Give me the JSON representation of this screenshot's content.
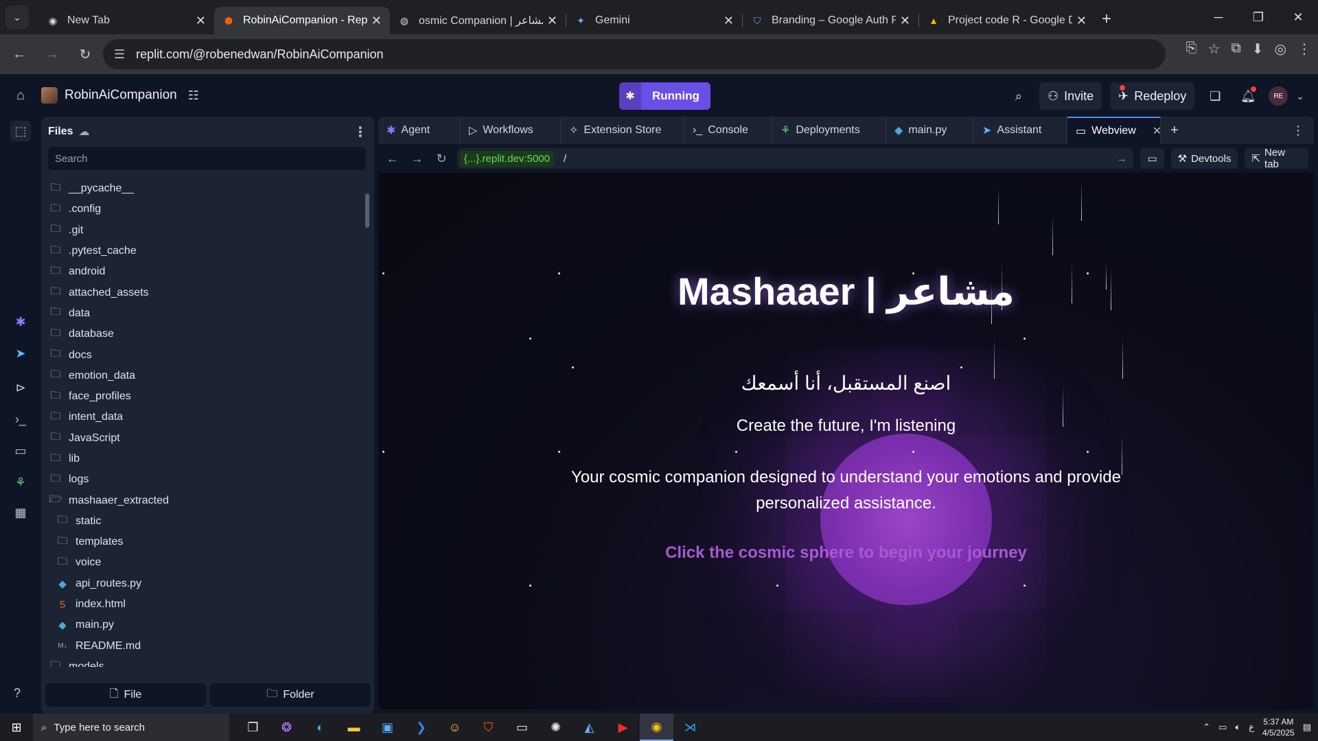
{
  "browser": {
    "tabs": [
      {
        "title": "New Tab",
        "icon": "chrome-icon"
      },
      {
        "title": "RobinAiCompanion - Repl",
        "icon": "replit-icon",
        "active": true
      },
      {
        "title": "osmic Companion | مشاعر",
        "icon": "globe-icon"
      },
      {
        "title": "Gemini",
        "icon": "gemini-icon"
      },
      {
        "title": "Branding – Google Auth P",
        "icon": "shield-icon"
      },
      {
        "title": "Project code R - Google D",
        "icon": "drive-icon"
      }
    ],
    "url": "replit.com/@robenedwan/RobinAiCompanion"
  },
  "replit": {
    "project_name": "RobinAiCompanion",
    "run_status": "Running",
    "invite_label": "Invite",
    "redeploy_label": "Redeploy",
    "user_initials": "RE"
  },
  "files": {
    "title": "Files",
    "search_placeholder": "Search",
    "items": [
      {
        "name": "__pycache__",
        "type": "folder",
        "depth": 0
      },
      {
        "name": ".config",
        "type": "folder",
        "depth": 0
      },
      {
        "name": ".git",
        "type": "folder",
        "depth": 0
      },
      {
        "name": ".pytest_cache",
        "type": "folder",
        "depth": 0
      },
      {
        "name": "android",
        "type": "folder",
        "depth": 0
      },
      {
        "name": "attached_assets",
        "type": "folder",
        "depth": 0
      },
      {
        "name": "data",
        "type": "folder",
        "depth": 0
      },
      {
        "name": "database",
        "type": "folder",
        "depth": 0
      },
      {
        "name": "docs",
        "type": "folder",
        "depth": 0
      },
      {
        "name": "emotion_data",
        "type": "folder",
        "depth": 0
      },
      {
        "name": "face_profiles",
        "type": "folder",
        "depth": 0
      },
      {
        "name": "intent_data",
        "type": "folder",
        "depth": 0
      },
      {
        "name": "JavaScript",
        "type": "folder",
        "depth": 0
      },
      {
        "name": "lib",
        "type": "folder",
        "depth": 0
      },
      {
        "name": "logs",
        "type": "folder",
        "depth": 0
      },
      {
        "name": "mashaaer_extracted",
        "type": "folder-open",
        "depth": 0
      },
      {
        "name": "static",
        "type": "folder",
        "depth": 1
      },
      {
        "name": "templates",
        "type": "folder",
        "depth": 1
      },
      {
        "name": "voice",
        "type": "folder",
        "depth": 1
      },
      {
        "name": "api_routes.py",
        "type": "python",
        "depth": 1
      },
      {
        "name": "index.html",
        "type": "html",
        "depth": 1
      },
      {
        "name": "main.py",
        "type": "python",
        "depth": 1
      },
      {
        "name": "README.md",
        "type": "markdown",
        "depth": 1
      },
      {
        "name": "models",
        "type": "folder",
        "depth": 0
      }
    ],
    "new_file_label": "File",
    "new_folder_label": "Folder"
  },
  "workspace": {
    "tabs": [
      {
        "label": "Agent",
        "icon": "agent-icon"
      },
      {
        "label": "Workflows",
        "icon": "play-icon"
      },
      {
        "label": "Extension Store",
        "icon": "puzzle-icon"
      },
      {
        "label": "Console",
        "icon": "terminal-icon"
      },
      {
        "label": "Deployments",
        "icon": "deploy-icon"
      },
      {
        "label": "main.py",
        "icon": "python-icon"
      },
      {
        "label": "Assistant",
        "icon": "assistant-icon"
      },
      {
        "label": "Webview",
        "icon": "monitor-icon",
        "active": true
      }
    ],
    "webview": {
      "url_chip": "{...}.replit.dev:5000",
      "path": "/",
      "devtools_label": "Devtools",
      "newtab_label": "New tab"
    }
  },
  "webpage": {
    "title": "Mashaaer | مشاعر",
    "subtitle_ar": "اصنع المستقبل، أنا أسمعك",
    "subtitle_en": "Create the future, I'm listening",
    "description": "Your cosmic companion designed to understand your emotions and provide personalized assistance.",
    "cta": "Click the cosmic sphere to begin your journey"
  },
  "taskbar": {
    "search_placeholder": "Type here to search",
    "time": "5:37 AM",
    "date": "4/5/2025"
  },
  "colors": {
    "running_bg": "#6a4ee6",
    "cta": "#a45bd0",
    "orb": "#7b2fae"
  }
}
